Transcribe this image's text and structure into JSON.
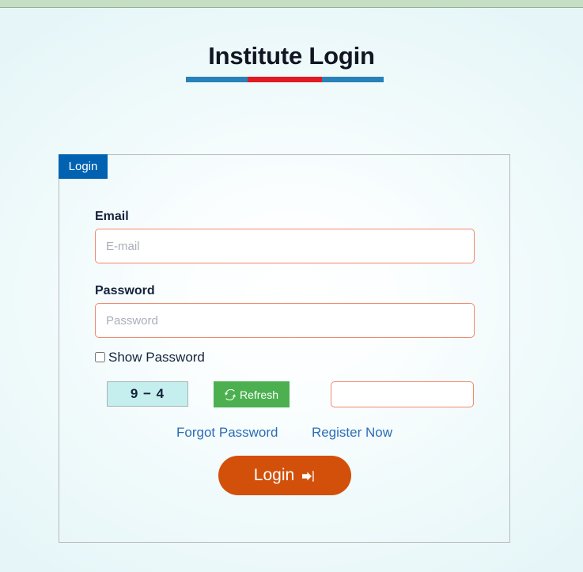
{
  "page": {
    "title": "Institute Login",
    "top_band_color": "#c6dfc4",
    "accent_blue": "#2981b9",
    "accent_red": "#e11b22"
  },
  "card": {
    "tab_label": "Login"
  },
  "form": {
    "email": {
      "label": "Email",
      "placeholder": "E-mail",
      "value": ""
    },
    "password": {
      "label": "Password",
      "placeholder": "Password",
      "value": ""
    },
    "show_password": {
      "label": "Show Password",
      "checked": false
    },
    "captcha": {
      "code": "9 − 4",
      "refresh_label": "Refresh",
      "refresh_icon": "refresh-icon",
      "answer_placeholder": "",
      "answer_value": ""
    },
    "links": {
      "forgot_password": "Forgot Password",
      "register_now": "Register Now"
    },
    "submit": {
      "label": "Login",
      "icon": "sign-in-icon"
    }
  }
}
